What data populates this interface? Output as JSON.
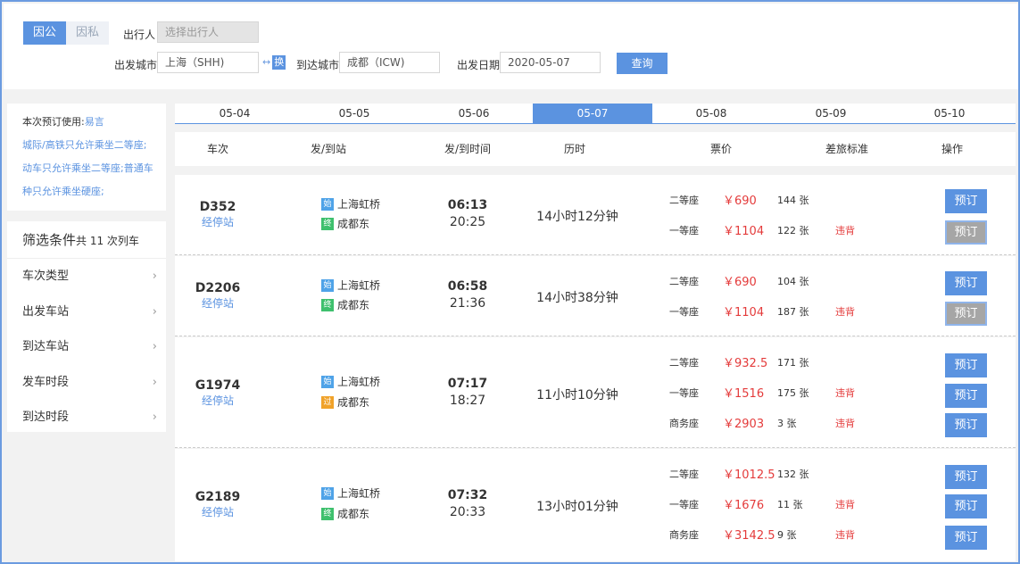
{
  "search": {
    "tab_business": "因公",
    "tab_private": "因私",
    "traveler_label": "出行人",
    "traveler_placeholder": "选择出行人",
    "from_label": "出发城市",
    "from_value": "上海（SHH)",
    "swap_label": "换",
    "to_label": "到达城市",
    "to_value": "成都（ICW)",
    "date_label": "出发日期",
    "date_value": "2020-05-07",
    "query_button": "查询"
  },
  "notice": {
    "prefix": "本次预订使用:",
    "link": "易言",
    "lines": [
      "城际/高铁只允许乘坐二等座;",
      "动车只允许乘坐二等座;普通车",
      "种只允许乘坐硬座;"
    ]
  },
  "filters": {
    "title": "筛选条件",
    "count": "共 11 次列车",
    "items": [
      "车次类型",
      "出发车站",
      "到达车站",
      "发车时段",
      "到达时段"
    ]
  },
  "dates": [
    "05-04",
    "05-05",
    "05-06",
    "05-07",
    "05-08",
    "05-09",
    "05-10"
  ],
  "selected_date": "05-07",
  "columns": [
    "车次",
    "发/到站",
    "发/到时间",
    "历时",
    "票价",
    "差旅标准",
    "操作"
  ],
  "trains": [
    {
      "no": "D352",
      "stops": "经停站",
      "from_tag": "始",
      "from": "上海虹桥",
      "to_tag": "终",
      "to": "成都东",
      "dep": "06:13",
      "arr": "20:25",
      "duration": "14小时12分钟",
      "seats": [
        {
          "name": "二等座",
          "price": "￥690",
          "count": "144 张",
          "violation": "",
          "book": "预订",
          "disabled": false
        },
        {
          "name": "一等座",
          "price": "￥1104",
          "count": "122 张",
          "violation": "违背",
          "book": "预订",
          "disabled": true
        }
      ]
    },
    {
      "no": "D2206",
      "stops": "经停站",
      "from_tag": "始",
      "from": "上海虹桥",
      "to_tag": "终",
      "to": "成都东",
      "dep": "06:58",
      "arr": "21:36",
      "duration": "14小时38分钟",
      "seats": [
        {
          "name": "二等座",
          "price": "￥690",
          "count": "104 张",
          "violation": "",
          "book": "预订",
          "disabled": false
        },
        {
          "name": "一等座",
          "price": "￥1104",
          "count": "187 张",
          "violation": "违背",
          "book": "预订",
          "disabled": true
        }
      ]
    },
    {
      "no": "G1974",
      "stops": "经停站",
      "from_tag": "始",
      "from": "上海虹桥",
      "to_tag": "过",
      "to": "成都东",
      "dep": "07:17",
      "arr": "18:27",
      "duration": "11小时10分钟",
      "seats": [
        {
          "name": "二等座",
          "price": "￥932.5",
          "count": "171 张",
          "violation": "",
          "book": "预订",
          "disabled": false
        },
        {
          "name": "一等座",
          "price": "￥1516",
          "count": "175 张",
          "violation": "违背",
          "book": "预订",
          "disabled": false
        },
        {
          "name": "商务座",
          "price": "￥2903",
          "count": "3 张",
          "violation": "违背",
          "book": "预订",
          "disabled": false
        }
      ]
    },
    {
      "no": "G2189",
      "stops": "经停站",
      "from_tag": "始",
      "from": "上海虹桥",
      "to_tag": "终",
      "to": "成都东",
      "dep": "07:32",
      "arr": "20:33",
      "duration": "13小时01分钟",
      "seats": [
        {
          "name": "二等座",
          "price": "￥1012.5",
          "count": "132 张",
          "violation": "",
          "book": "预订",
          "disabled": false
        },
        {
          "name": "一等座",
          "price": "￥1676",
          "count": "11 张",
          "violation": "违背",
          "book": "预订",
          "disabled": false
        },
        {
          "name": "商务座",
          "price": "￥3142.5",
          "count": "9 张",
          "violation": "违背",
          "book": "预订",
          "disabled": false
        }
      ]
    }
  ]
}
